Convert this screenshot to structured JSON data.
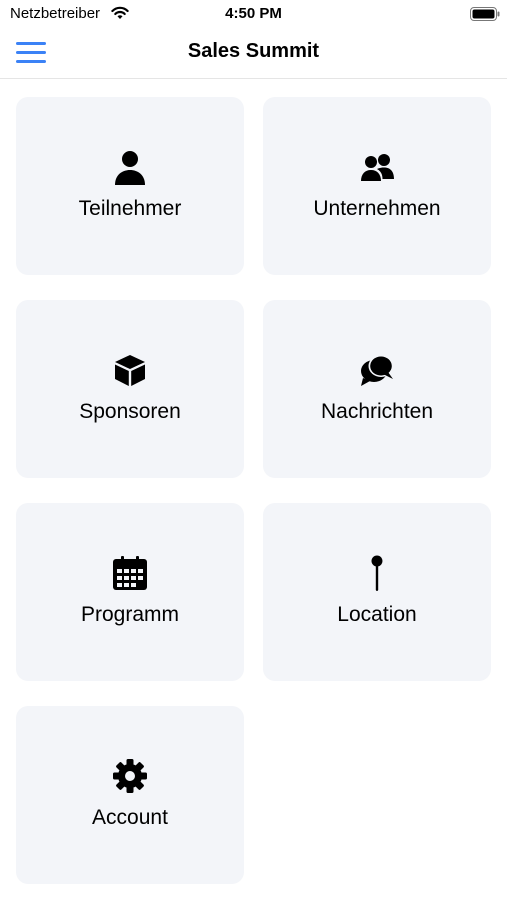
{
  "status_bar": {
    "carrier": "Netzbetreiber",
    "time": "4:50 PM"
  },
  "nav": {
    "title": "Sales Summit",
    "menu_icon": "hamburger-icon",
    "accent_color": "#3b82f6"
  },
  "tiles": [
    {
      "label": "Teilnehmer",
      "icon": "person-icon"
    },
    {
      "label": "Unternehmen",
      "icon": "people-icon"
    },
    {
      "label": "Sponsoren",
      "icon": "cube-icon"
    },
    {
      "label": "Nachrichten",
      "icon": "chat-bubbles-icon"
    },
    {
      "label": "Programm",
      "icon": "calendar-icon"
    },
    {
      "label": "Location",
      "icon": "map-pin-icon"
    },
    {
      "label": "Account",
      "icon": "gear-icon"
    }
  ]
}
